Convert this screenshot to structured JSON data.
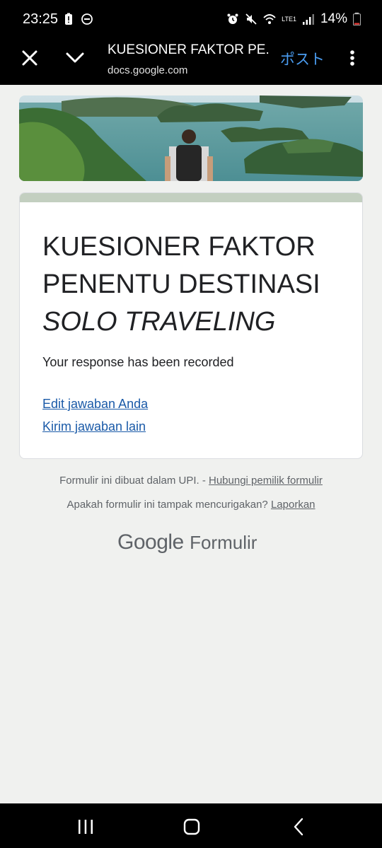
{
  "status_bar": {
    "time": "23:25",
    "battery": "14%",
    "network_label": "LTE1"
  },
  "toolbar": {
    "title": "KUESIONER FAKTOR PE...",
    "url": "docs.google.com",
    "post_label": "ポスト"
  },
  "form": {
    "title_line1": "KUESIONER FAKTOR",
    "title_line2": "PENENTU DESTINASI",
    "title_line3": "SOLO TRAVELING",
    "confirmation": "Your response has been recorded",
    "edit_link": "Edit jawaban Anda",
    "another_link": "Kirim jawaban lain"
  },
  "footer": {
    "created_text": "Formulir ini dibuat dalam UPI. - ",
    "contact_link": "Hubungi pemilik formulir",
    "suspicious_text": "Apakah formulir ini tampak mencurigakan? ",
    "report_link": "Laporkan",
    "logo_google": "Google",
    "logo_forms": "Formulir"
  },
  "colors": {
    "accent": "#c3cfc0",
    "link": "#1a5aa8",
    "post": "#4a9cf0"
  }
}
